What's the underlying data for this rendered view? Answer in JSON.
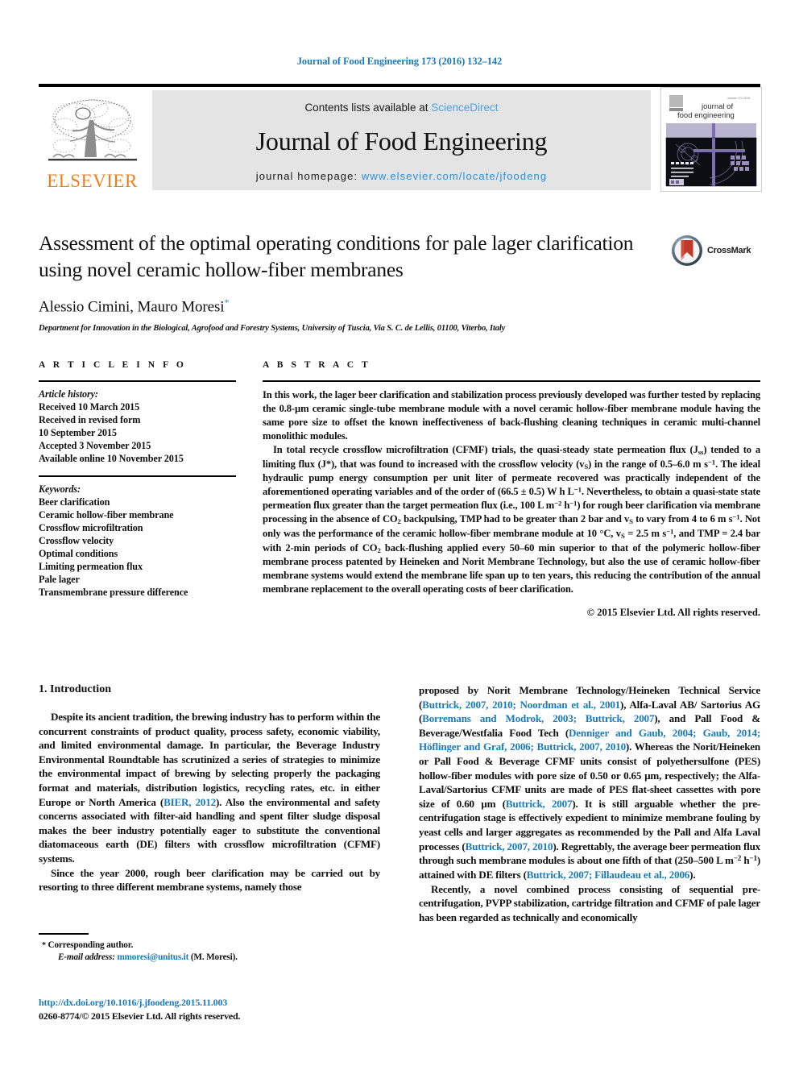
{
  "running_head": "Journal of Food Engineering 173 (2016) 132–142",
  "masthead": {
    "contents_prefix": "Contents lists available at ",
    "sciencedirect": "ScienceDirect",
    "journal_title": "Journal of Food Engineering",
    "homepage_prefix": "journal homepage: ",
    "homepage_url": "www.elsevier.com/locate/jfoodeng",
    "publisher_wordmark": "ELSEVIER",
    "cover_line1": "journal of",
    "cover_line2": "food engineering",
    "banner_bg": "#e4e4e4",
    "link_color": "#2b8fd6",
    "elsevier_orange": "#F07F1A"
  },
  "article": {
    "title": "Assessment of the optimal operating conditions for pale lager clarification using novel ceramic hollow-fiber membranes",
    "authors": "Alessio Cimini, Mauro Moresi",
    "corresponding_marker": "*",
    "affiliation": "Department for Innovation in the Biological, Agrofood and Forestry Systems, University of Tuscia, Via S. C. de Lellis, 01100, Viterbo, Italy",
    "crossmark_label": "CrossMark"
  },
  "info": {
    "heading": "A R T I C L E   I N F O",
    "history_label": "Article history:",
    "history": [
      "Received 10 March 2015",
      "Received in revised form",
      "10 September 2015",
      "Accepted 3 November 2015",
      "Available online 10 November 2015"
    ],
    "keywords_label": "Keywords:",
    "keywords": [
      "Beer clarification",
      "Ceramic hollow-fiber membrane",
      "Crossflow microfiltration",
      "Crossflow velocity",
      "Optimal conditions",
      "Limiting permeation flux",
      "Pale lager",
      "Transmembrane pressure difference"
    ]
  },
  "abstract": {
    "heading": "A B S T R A C T",
    "paragraph1": "In this work, the lager beer clarification and stabilization process previously developed was further tested by replacing the 0.8-µm ceramic single-tube membrane module with a novel ceramic hollow-fiber membrane module having the same pore size to offset the known ineffectiveness of back-flushing cleaning techniques in ceramic multi-channel monolithic modules.",
    "copyright": "© 2015 Elsevier Ltd. All rights reserved."
  },
  "introduction": {
    "section_number": "1.",
    "section_title": "Introduction",
    "left_p1": "Despite its ancient tradition, the brewing industry has to perform within the concurrent constraints of product quality, process safety, economic viability, and limited environmental damage. In particular, the Beverage Industry Environmental Roundtable has scrutinized a series of strategies to minimize the environmental impact of brewing by selecting properly the packaging format and materials, distribution logistics, recycling rates, etc. in either Europe or North America (",
    "left_cite1": "BIER, 2012",
    "left_p1b": "). Also the environmental and safety concerns associated with filter-aid handling and spent filter sludge disposal makes the beer industry potentially eager to substitute the conventional diatomaceous earth (DE) filters with crossflow microfiltration (CFMF) systems.",
    "left_p2": "Since the year 2000, rough beer clarification may be carried out by resorting to three different membrane systems, namely those"
  },
  "footnote": {
    "corresponding_star": "*",
    "corresponding_text": "Corresponding author.",
    "email_label": "E-mail address:",
    "email": "mmoresi@unitus.it",
    "email_suffix": "(M. Moresi)."
  },
  "doi": {
    "url": "http://dx.doi.org/10.1016/j.jfoodeng.2015.11.003",
    "issn_line": "0260-8774/© 2015 Elsevier Ltd. All rights reserved."
  }
}
